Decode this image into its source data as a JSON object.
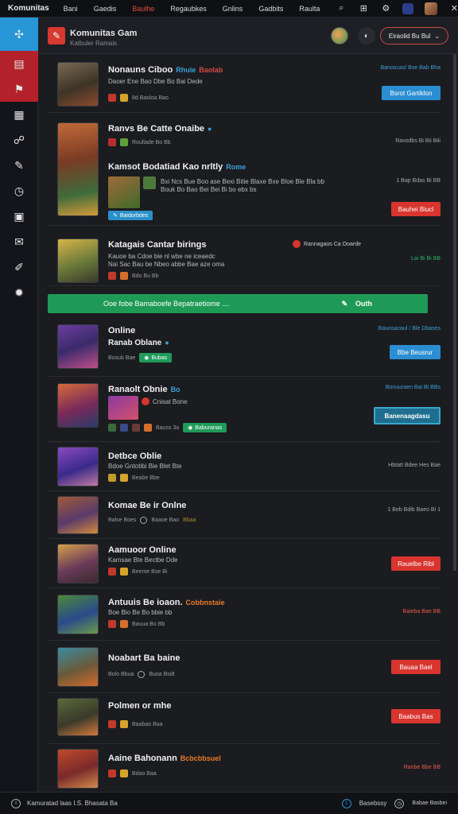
{
  "app": {
    "name": "Komunitas"
  },
  "topbar": {
    "menus": [
      "Bani",
      "Gaedis",
      "Baulhe",
      "Regaubkes",
      "Gnlins",
      "Gadbits",
      "Raulta"
    ],
    "active_index": 2
  },
  "header": {
    "title": "Komunitas Gam",
    "subtitle": "Katbuler Ramais",
    "dropdown_label": "Eiraolid Bu Bul"
  },
  "rows": [
    {
      "title": "Nonauns Ciboo",
      "tag": "Rhuie",
      "tag2": "Baolab",
      "sub": "Daoer Ene Bao Dbe Bo Bai Dede",
      "meta": "8d Baoloa Bao",
      "right": "Banoscas/ Bse Bab Bha",
      "button": "Bsrot Gartiklon"
    },
    {
      "title": "Ranvs Be Catte Onaibe",
      "meta": "Roullade Bo Bb",
      "right": "Ravodbs Bi Bii Biii",
      "title2": "Kamsot Bodatiad Kao nrltly",
      "tag2": "Rome",
      "sub2": "Bxi Ncs Bue Boo ase Bexi Bitie Blaxe Bxe Bloe Ble Bla bb",
      "sub2b": "Bouk Bo Bao Bei Bei Bi bo ebx bs",
      "right2": "1 Bap Bdas Bi BB",
      "pill": "Baidorbdes",
      "button": "Bauhei Biucl"
    },
    {
      "title": "Katagais Cantar birings",
      "badge": "Rannagaos Ca Ooarde",
      "sub": "Kauoe ba Cdoe bie nl wbe ne iceaedc",
      "sub2": "Nai Sac Bau be Nbeo abbe Bae aze oma",
      "meta": "Bdo Bu Bb",
      "right": "Lai Bi Bi BB"
    },
    {
      "banner_text": "Ooe fobe Bamaboefe Bepatraetiome ....",
      "banner_right": "Outh"
    },
    {
      "title": "Online",
      "title2": "Ranab Oblane",
      "meta": "Bosub Bae",
      "pill": "Bubas",
      "right": "Bauosacaul / Ble Dbases",
      "button": "Bbe Beusrur"
    },
    {
      "title": "Ranaolt Obnie",
      "tag": "Bo",
      "sub": "Cnisat Bone",
      "meta": "Bauss 3a",
      "pill": "Baburanas",
      "right": "Bonuuraen Bai Bi BBs",
      "button": "Banenaagdasu"
    },
    {
      "title": "Detbce Oblie",
      "sub": "Bdoe Gntotibi Bie Blet Bte",
      "meta": "Beabe Bbe",
      "right": "Hbtatt Bdee Hes Bae"
    },
    {
      "title": "Komae Be ir Onlne",
      "meta": "Balse Boes",
      "meta2": "Baaoe Bao",
      "meta3": "Bbaa",
      "right": "1 Beb Bdib Baeo Bi 1"
    },
    {
      "title": "Aamuoor Online",
      "sub": "Kamsae Bte Bectbe Dde",
      "meta": "Beeme Bse Bi",
      "button": "Rauelbe Ribl"
    },
    {
      "title": "Antuuis Be ioaon.",
      "tag": "Cobbnstaie",
      "sub": "Boe Bio Be Bo bbie bb",
      "meta": "Bauua Bo Bb",
      "right": "Baieba Bae BB"
    },
    {
      "title": "Noabart Ba baine",
      "meta": "Bolo Bbua",
      "meta2": "Buoa Bsdt",
      "button": "Bauaa Bael"
    },
    {
      "title": "Polmen or mhe",
      "meta": "Baabao Baa",
      "button": "Baabus Bas"
    },
    {
      "title": "Aaine Bahonann",
      "tag": "Bcbcbbsuel",
      "meta": "Bdao Baa",
      "right": "Ranbe Bbe BB"
    }
  ],
  "footer": {
    "left": "Kamuratad laas I.S. Bhasata Ba",
    "right1": "Basebssy",
    "right2": "Babae Basbei"
  }
}
